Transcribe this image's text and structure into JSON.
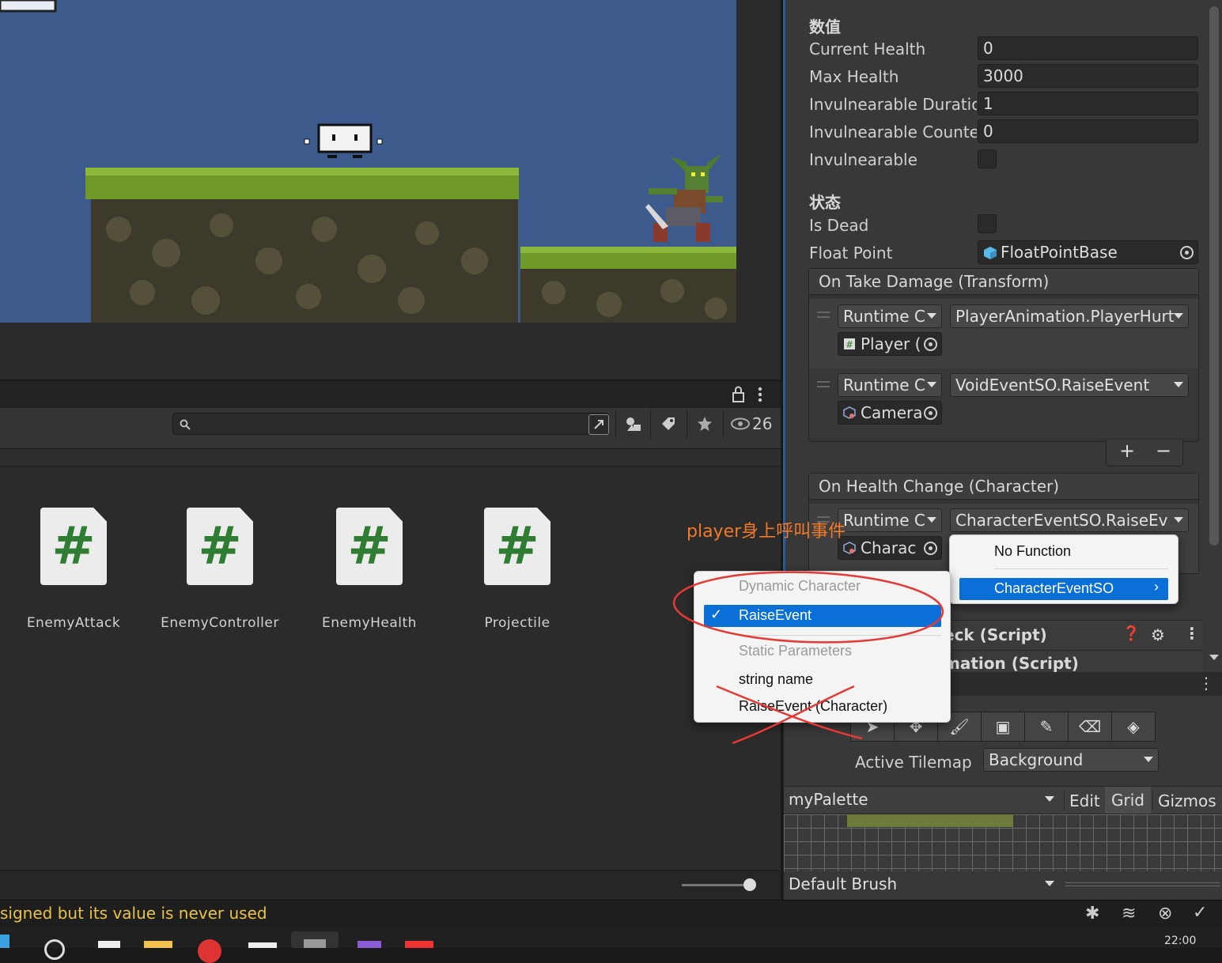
{
  "inspector": {
    "header_values": "数值",
    "fields": [
      {
        "label": "Current Health",
        "value": "0"
      },
      {
        "label": "Max Health",
        "value": "3000"
      },
      {
        "label": "Invulnearable Duratio",
        "value": "1"
      },
      {
        "label": "Invulnearable Counte",
        "value": "0"
      }
    ],
    "invulnerable_label": "Invulneareable",
    "invulnerable_label_exact": "Invulnearable",
    "invulnerable_checked": false,
    "header_state": "状态",
    "is_dead_label": "Is Dead",
    "is_dead_checked": false,
    "float_point_label": "Float Point",
    "float_point_value": "FloatPointBase",
    "on_take_damage": {
      "title": "On Take Damage (Transform)",
      "entries": [
        {
          "mode": "Runtime C",
          "function": "PlayerAnimation.PlayerHurt",
          "object": "Player ("
        },
        {
          "mode": "Runtime C",
          "function": "VoidEventSO.RaiseEvent",
          "object": "Camera"
        }
      ],
      "add_label": "+",
      "remove_label": "−"
    },
    "on_health_change": {
      "title": "On Health Change (Character)",
      "entries": [
        {
          "mode": "Runtime C",
          "function": "CharacterEventSO.RaiseEv",
          "object": "Charac"
        }
      ]
    },
    "components": [
      {
        "name": "eck (Script)"
      },
      {
        "name": "mation (Script)"
      }
    ]
  },
  "project": {
    "search_placeholder": "",
    "hidden_count": "26",
    "assets": [
      {
        "name": "EnemyAttack",
        "glyph": "#"
      },
      {
        "name": "EnemyController",
        "glyph": "#"
      },
      {
        "name": "EnemyHealth",
        "glyph": "#"
      },
      {
        "name": "Projectile",
        "glyph": "#"
      }
    ]
  },
  "status": {
    "message": "signed but its value is never used"
  },
  "function_menu": {
    "items": [
      {
        "label": "No Function"
      },
      {
        "label": "CharacterEventSO",
        "selected": true,
        "submenu": "›"
      }
    ]
  },
  "submenu": {
    "section_dynamic": "Dynamic Character",
    "raise_event_selected": "RaiseEvent",
    "checkmark": "✓",
    "section_static": "Static Parameters",
    "string_name": "string name",
    "raise_event_static": "RaiseEvent (Character)"
  },
  "annotation": {
    "text": "player身上呼叫事件",
    "color": "#f07a2a",
    "ink_color": "#e53935"
  },
  "palette": {
    "active_tilemap_label": "Active Tilemap",
    "active_tilemap_value": "Background",
    "palette_name": "myPalette",
    "edit_label": "Edit",
    "grid_label": "Grid",
    "gizmos_label": "Gizmos",
    "brush_label": "Default Brush"
  },
  "clock": "22:00"
}
